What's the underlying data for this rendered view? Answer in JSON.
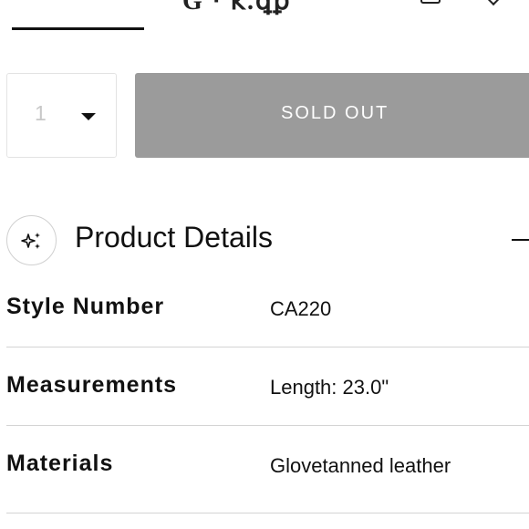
{
  "top": {
    "tab_text": "G  ⋅  ꝁ.ꝗꝑ",
    "icons": [
      "bag-icon",
      "chevron-icon"
    ]
  },
  "purchase": {
    "quantity": "1",
    "quantity_icon": "caret-down-icon",
    "button_label": "SOLD OUT",
    "button_color": "#9b9b9b"
  },
  "details": {
    "title": "Product Details",
    "badge_icon": "sparkle-icon",
    "toggle_icon": "minus-icon",
    "rows": [
      {
        "label": "Style Number",
        "value": "CA220"
      },
      {
        "label": "Measurements",
        "value": "Length: 23.0\""
      },
      {
        "label": "Materials",
        "value": "Glovetanned leather"
      }
    ]
  }
}
